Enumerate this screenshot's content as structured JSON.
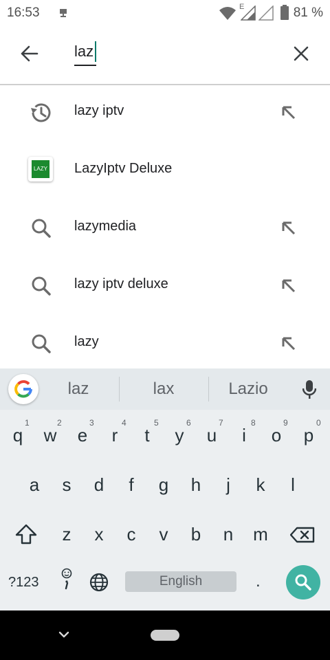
{
  "status": {
    "time": "16:53",
    "network": "E",
    "battery": "81 %"
  },
  "search": {
    "query": "laz"
  },
  "suggestions": [
    {
      "label": "lazy iptv",
      "type": "history"
    },
    {
      "label": "LazyIptv Deluxe",
      "type": "app",
      "app_icon_text": "LAZY"
    },
    {
      "label": "lazymedia",
      "type": "search"
    },
    {
      "label": "lazy iptv deluxe",
      "type": "search"
    },
    {
      "label": "lazy",
      "type": "search"
    }
  ],
  "keyboard": {
    "suggestions": [
      "laz",
      "lax",
      "Lazio"
    ],
    "row1": [
      "q",
      "w",
      "e",
      "r",
      "t",
      "y",
      "u",
      "i",
      "o",
      "p"
    ],
    "row1_hints": [
      "1",
      "2",
      "3",
      "4",
      "5",
      "6",
      "7",
      "8",
      "9",
      "0"
    ],
    "row2": [
      "a",
      "s",
      "d",
      "f",
      "g",
      "h",
      "j",
      "k",
      "l"
    ],
    "row3": [
      "z",
      "x",
      "c",
      "v",
      "b",
      "n",
      "m"
    ],
    "symbols_label": "?123",
    "space_label": "English",
    "period_label": ".",
    "accent_color": "#41b3a3"
  }
}
